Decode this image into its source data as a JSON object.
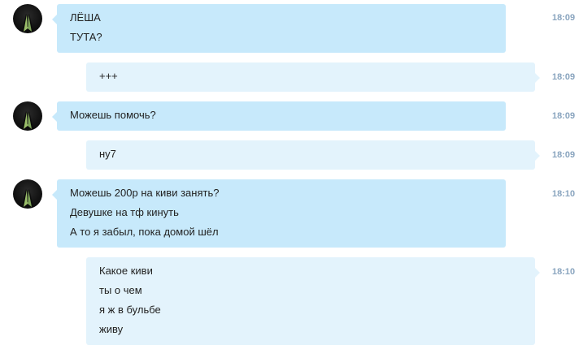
{
  "colors": {
    "incoming_bubble": "#c7e9fb",
    "outgoing_bubble": "#e3f3fc",
    "timestamp": "#8aa5bf"
  },
  "messages": [
    {
      "direction": "incoming",
      "avatar_icon": "suit-avatar-icon",
      "lines": [
        "ЛЁША",
        "ТУТА?"
      ],
      "time": "18:09"
    },
    {
      "direction": "outgoing",
      "lines": [
        "+++"
      ],
      "time": "18:09"
    },
    {
      "direction": "incoming",
      "avatar_icon": "suit-avatar-icon",
      "lines": [
        "Можешь помочь?"
      ],
      "time": "18:09"
    },
    {
      "direction": "outgoing",
      "lines": [
        "ну7"
      ],
      "time": "18:09"
    },
    {
      "direction": "incoming",
      "avatar_icon": "suit-avatar-icon",
      "lines": [
        "Можешь 200р на киви занять?",
        "Девушке на тф кинуть",
        "А то я забыл, пока домой шёл"
      ],
      "time": "18:10"
    },
    {
      "direction": "outgoing",
      "lines": [
        "Какое киви",
        "ты о чем",
        "я ж в бульбе",
        "живу"
      ],
      "time": "18:10"
    }
  ]
}
